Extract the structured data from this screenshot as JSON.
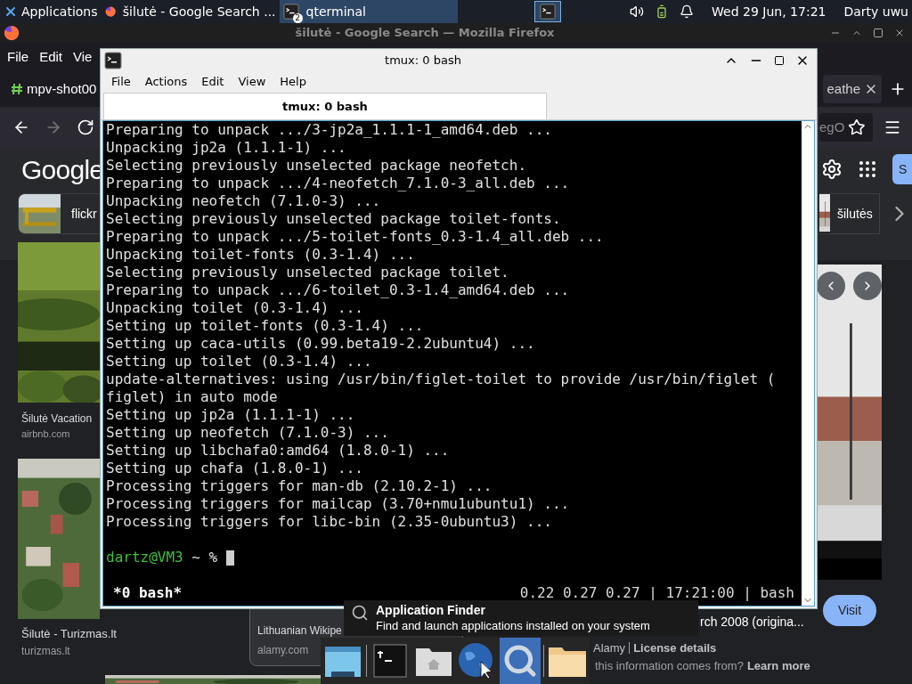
{
  "panel": {
    "apps_menu": "Applications",
    "tasks": [
      {
        "label": "šilutė - Google Search ...",
        "kind": "browser",
        "selected": false
      },
      {
        "label": "qterminal",
        "kind": "terminal",
        "badge": "2",
        "selected": true
      }
    ],
    "clock": "Wed 29 Jun, 17:21",
    "user": "Darty uwu"
  },
  "firefox": {
    "title": "šilutė - Google Search — Mozilla Firefox",
    "menu": [
      "File",
      "Edit",
      "Vie"
    ],
    "tabs": [
      {
        "label": "mpv-shot00",
        "selected": false
      },
      {
        "label": "eathe",
        "selected": true
      }
    ],
    "url_fragment": "egO",
    "google": {
      "logo": "Google",
      "header_button": "S",
      "chips": [
        {
          "label": "flickr"
        },
        {
          "label": "šilutės"
        }
      ]
    },
    "results": [
      {
        "title": "Šilutė Vacation",
        "source": "airbnb.com"
      },
      {
        "title": "Šilutė - Turizmas.lt",
        "source": "turizmas.lt"
      },
      {
        "title": "Lithuanian Wikipe",
        "source": "alamy.com"
      }
    ],
    "preview": {
      "visit": "Visit",
      "caption": "rch 2008 (origina...",
      "credit": "Alamy",
      "credit_link": "License details",
      "question": "this information comes from?",
      "learn_more": "Learn more"
    }
  },
  "terminal": {
    "title": "tmux: 0 bash",
    "menu": [
      "File",
      "Actions",
      "Edit",
      "View",
      "Help"
    ],
    "tab": "tmux: 0 bash",
    "lines": [
      "Preparing to unpack .../3-jp2a_1.1.1-1_amd64.deb ...",
      "Unpacking jp2a (1.1.1-1) ...",
      "Selecting previously unselected package neofetch.",
      "Preparing to unpack .../4-neofetch_7.1.0-3_all.deb ...",
      "Unpacking neofetch (7.1.0-3) ...",
      "Selecting previously unselected package toilet-fonts.",
      "Preparing to unpack .../5-toilet-fonts_0.3-1.4_all.deb ...",
      "Unpacking toilet-fonts (0.3-1.4) ...",
      "Selecting previously unselected package toilet.",
      "Preparing to unpack .../6-toilet_0.3-1.4_amd64.deb ...",
      "Unpacking toilet (0.3-1.4) ...",
      "Setting up toilet-fonts (0.3-1.4) ...",
      "Setting up caca-utils (0.99.beta19-2.2ubuntu4) ...",
      "Setting up toilet (0.3-1.4) ...",
      "update-alternatives: using /usr/bin/figlet-toilet to provide /usr/bin/figlet (",
      "figlet) in auto mode",
      "Setting up jp2a (1.1.1-1) ...",
      "Setting up neofetch (7.1.0-3) ...",
      "Setting up libchafa0:amd64 (1.8.0-1) ...",
      "Setting up chafa (1.8.0-1) ...",
      "Processing triggers for man-db (2.10.2-1) ...",
      "Processing triggers for mailcap (3.70+nmu1ubuntu1) ...",
      "Processing triggers for libc-bin (2.35-0ubuntu3) ..."
    ],
    "prompt": {
      "user": "dartz@VM3",
      "path": "~ %"
    },
    "status": {
      "left": "*0 bash*",
      "right": "0.22 0.27 0.27 | 17:21:00 | bash"
    }
  },
  "tooltip": {
    "title": "Application Finder",
    "text": "Find and launch applications installed on your system"
  },
  "dock": [
    {
      "kind": "desktop",
      "selected": false
    },
    {
      "kind": "separator",
      "selected": false
    },
    {
      "kind": "terminal",
      "selected": false
    },
    {
      "kind": "home",
      "selected": false
    },
    {
      "kind": "globe",
      "selected": false
    },
    {
      "kind": "search",
      "selected": true
    },
    {
      "kind": "separator",
      "selected": false
    },
    {
      "kind": "folder",
      "selected": false
    }
  ]
}
